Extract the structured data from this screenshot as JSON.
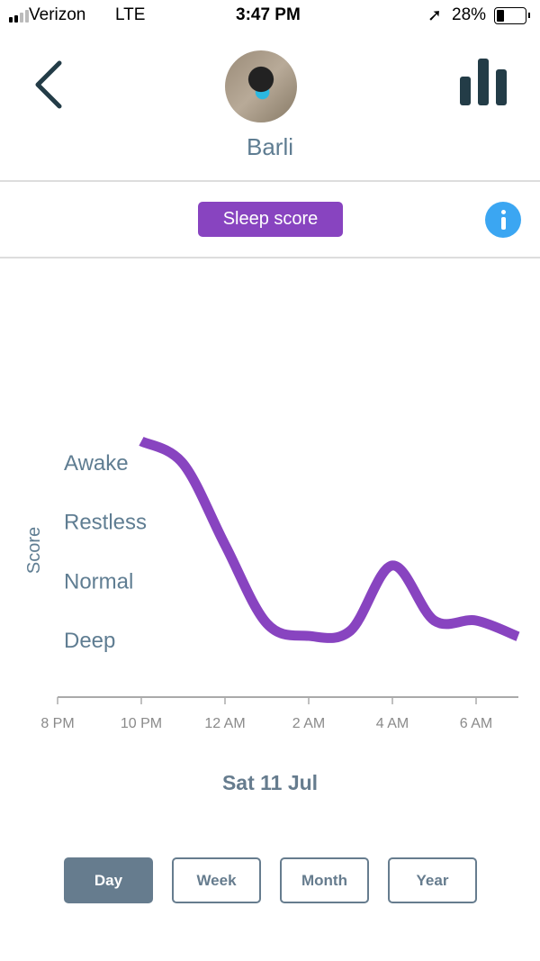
{
  "status_bar": {
    "carrier": "Verizon",
    "network": "LTE",
    "time": "3:47 PM",
    "battery": "28%"
  },
  "header": {
    "pet_name": "Barli"
  },
  "metric": {
    "label": "Sleep score"
  },
  "chart_data": {
    "type": "line",
    "ylabel": "Score",
    "y_categories": [
      "Deep",
      "Normal",
      "Restless",
      "Awake"
    ],
    "x_ticks": [
      "8 PM",
      "10 PM",
      "12 AM",
      "2 AM",
      "4 AM",
      "6 AM"
    ],
    "xlim": [
      "8 PM",
      "7 AM"
    ],
    "color": "#8844c0",
    "grid": false,
    "series": [
      {
        "points": [
          {
            "x": "10 PM",
            "y": 4.35
          },
          {
            "x": "11 PM",
            "y": 3.97
          },
          {
            "x": "12 AM",
            "y": 2.6
          },
          {
            "x": "1 AM",
            "y": 1.27
          },
          {
            "x": "2 AM",
            "y": 1.06
          },
          {
            "x": "3 AM",
            "y": 1.15
          },
          {
            "x": "4 AM",
            "y": 2.25
          },
          {
            "x": "5 AM",
            "y": 1.32
          },
          {
            "x": "6 AM",
            "y": 1.32
          },
          {
            "x": "7 AM",
            "y": 1.05
          }
        ]
      }
    ]
  },
  "date_label": "Sat 11 Jul",
  "ranges": [
    {
      "label": "Day",
      "active": true
    },
    {
      "label": "Week"
    },
    {
      "label": "Month"
    },
    {
      "label": "Year"
    }
  ]
}
